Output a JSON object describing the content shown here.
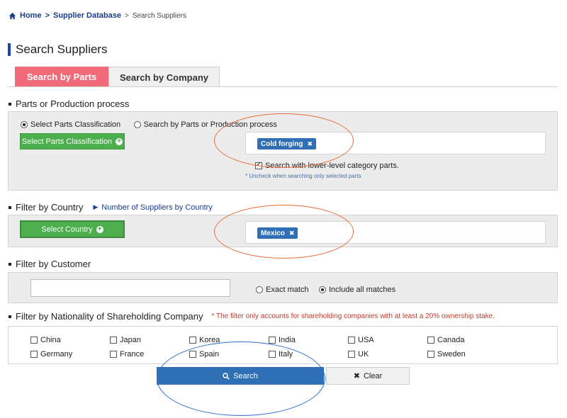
{
  "breadcrumb": {
    "home": "Home",
    "sep1": ">",
    "db": "Supplier Database",
    "sep2": ">",
    "current": "Search Suppliers"
  },
  "page_title": "Search Suppliers",
  "tabs": {
    "parts": "Search by Parts",
    "company": "Search by Company"
  },
  "parts_section": {
    "heading": "Parts or Production process",
    "radio_classification": "Select Parts Classification",
    "radio_search": "Search by Parts or Production process",
    "select_button": "Select Parts Classification",
    "selected_tag": "Cold forging",
    "tag_remove": "✖",
    "lower_level_label": "Search with lower-level category parts.",
    "note": "* Uncheck when searching only selected parts"
  },
  "country_section": {
    "heading": "Filter by Country",
    "link": "Number of Suppliers by Country",
    "select_button": "Select Country",
    "selected_tag": "Mexico",
    "tag_remove": "✖"
  },
  "customer_section": {
    "heading": "Filter by Customer",
    "input_value": "",
    "exact_match": "Exact match",
    "include_all": "Include all matches"
  },
  "nationality_section": {
    "heading": "Filter by Nationality of Shareholding Company",
    "note": "* The filter only accounts for shareholding companies with at least a 20% ownership stake.",
    "row1": [
      "China",
      "Japan",
      "Korea",
      "India",
      "USA",
      "Canada"
    ],
    "row2": [
      "Germany",
      "France",
      "Spain",
      "Italy",
      "UK",
      "Sweden"
    ]
  },
  "actions": {
    "search": "Search",
    "clear": "Clear"
  },
  "colors": {
    "accent_blue": "#2f6fb5",
    "tab_active": "#f06a79",
    "green": "#4cae4c",
    "orange_annotation": "#e8703a",
    "blue_annotation": "#2f6fd0"
  }
}
